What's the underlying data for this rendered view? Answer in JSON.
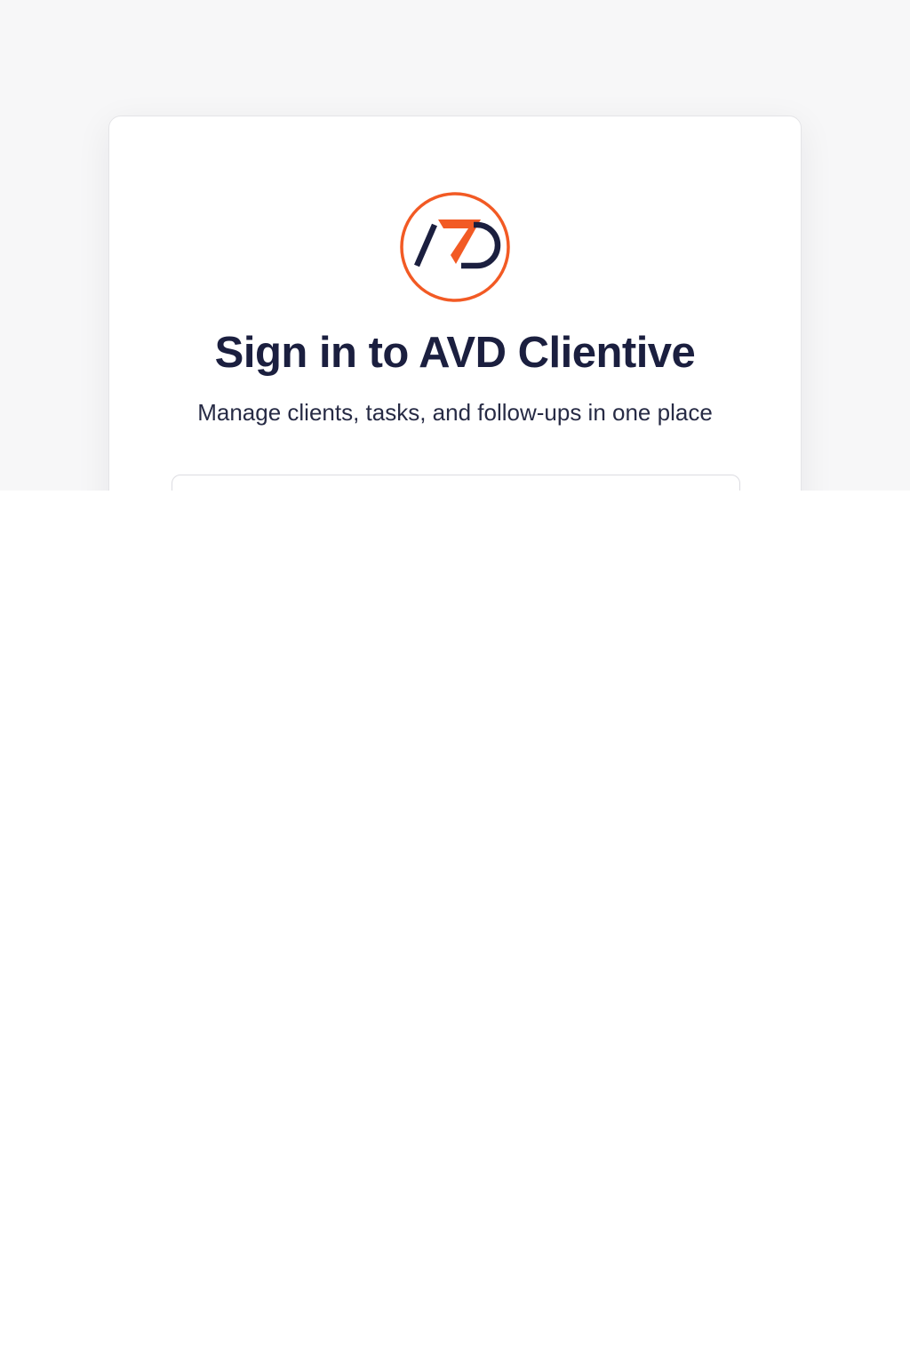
{
  "brand": {
    "logo_icon": "avd-monogram-logo",
    "logo_text": "AVD",
    "colors": {
      "accent": "#f25a24",
      "navy": "#1b1f3f",
      "background": "#f7f7f8",
      "card": "#ffffff",
      "border": "#e4e4e7"
    }
  },
  "signin": {
    "title": "Sign in to AVD Clientive",
    "subtitle": "Manage clients, tasks, and follow-ups in one place"
  }
}
